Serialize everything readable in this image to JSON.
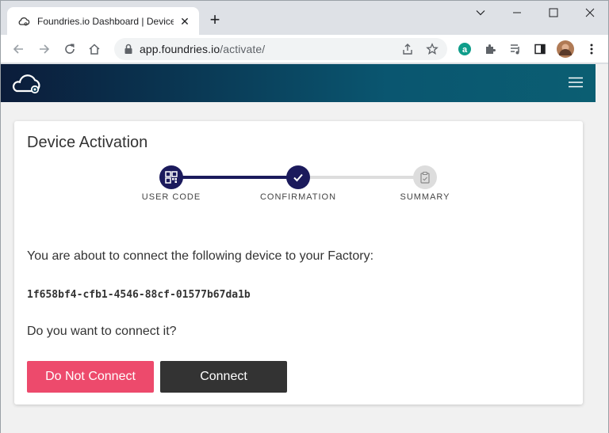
{
  "browser": {
    "tab_title": "Foundries.io Dashboard | Device",
    "url_host": "app.foundries.io",
    "url_path": "/activate/"
  },
  "card": {
    "title": "Device Activation",
    "steps": [
      {
        "label": "USER CODE",
        "state": "done"
      },
      {
        "label": "CONFIRMATION",
        "state": "done"
      },
      {
        "label": "SUMMARY",
        "state": "pending"
      }
    ],
    "intro": "You are about to connect the following device to your Factory:",
    "device_id": "1f658bf4-cfb1-4546-88cf-01577b67da1b",
    "question": "Do you want to connect it?",
    "buttons": {
      "reject": "Do Not Connect",
      "accept": "Connect"
    }
  },
  "colors": {
    "step_active": "#1b1a5c",
    "step_inactive": "#dddddd",
    "reject_button": "#ed4a6c",
    "accept_button": "#333333"
  },
  "icons": [
    "cloud-gear-icon",
    "tab-close-icon",
    "new-tab-icon",
    "back-icon",
    "forward-icon",
    "reload-icon",
    "home-icon",
    "lock-icon",
    "share-icon",
    "star-icon",
    "extension-a-icon",
    "puzzle-icon",
    "media-icon",
    "sidepanel-icon",
    "profile-avatar",
    "more-vert-icon",
    "hamburger-icon",
    "qr-code-icon",
    "check-icon",
    "clipboard-icon"
  ]
}
